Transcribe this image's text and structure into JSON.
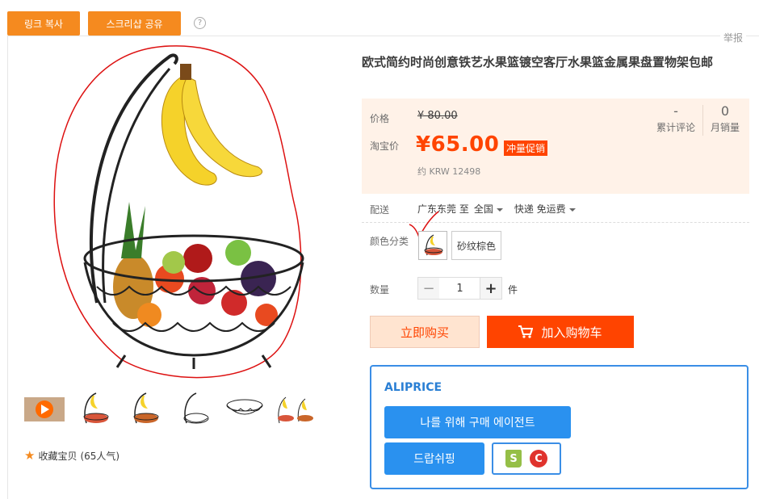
{
  "toolbar": {
    "copy_link": "링크 복사",
    "share_screenshot": "스크리샵 공유",
    "help": "?"
  },
  "report": "举报",
  "product": {
    "title": "欧式简约时尚创意铁艺水果篮镀空客厅水果篮金属果盘置物架包邮",
    "price_label": "价格",
    "original_price": "¥ 80.00",
    "promo_label": "淘宝价",
    "promo_price": "¥65.00",
    "promo_badge": "冲量促销",
    "approx_krw": "约 KRW 12498",
    "reviews_count": "-",
    "reviews_label": "累计评论",
    "monthly_sales": "0",
    "monthly_sales_label": "月销量"
  },
  "shipping": {
    "label": "配送",
    "from": "广东东莞 至",
    "to": "全国",
    "method": "快递 免运费"
  },
  "color": {
    "label": "颜色分类",
    "option_text": "砂纹棕色"
  },
  "quantity": {
    "label": "数量",
    "minus": "−",
    "value": "1",
    "plus": "+",
    "unit": "件"
  },
  "actions": {
    "buy_now": "立即购买",
    "add_cart": "加入购物车"
  },
  "aliprice": {
    "brand": "ALIPRICE",
    "agent_button": "나를 위해 구매 에이전트",
    "dropship_button": "드랍쉬핑",
    "shopify_letter": "S",
    "c_letter": "C"
  },
  "favorite": {
    "label": "收藏宝贝",
    "count": "(65人气)"
  },
  "colors": {
    "orange": "#f58a1f",
    "price_red": "#ff4400",
    "ali_blue": "#2a91ef"
  }
}
